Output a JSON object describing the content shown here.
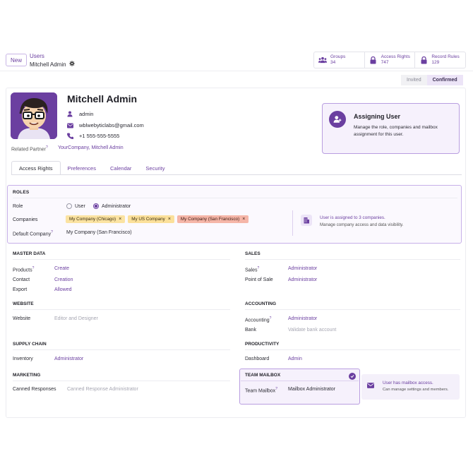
{
  "breadcrumb": {
    "parent": "Users",
    "current": "Mitchell Admin"
  },
  "buttons": {
    "new_label": "New"
  },
  "stats": [
    {
      "label": "Groups",
      "value": "34",
      "icon": "users-icon"
    },
    {
      "label": "Access Rights",
      "value": "747",
      "icon": "lock-icon"
    },
    {
      "label": "Record Rules",
      "value": "129",
      "icon": "lock-icon"
    }
  ],
  "status": {
    "invited": "Invited",
    "confirmed": "Confirmed"
  },
  "user": {
    "name": "Mitchell Admin",
    "login": "admin",
    "email": "wblwebyticlabs@gmail.com",
    "phone": "+1 555-555-5555",
    "related_partner_label": "Related Partner",
    "related_partner_value": "YourCompany, Mitchell Admin",
    "help_mark": "?"
  },
  "assign_card": {
    "title": "Assigning User",
    "desc": "Manage the role, companies and mailbox assignment for this user."
  },
  "tabs": [
    "Access Rights",
    "Preferences",
    "Calendar",
    "Security"
  ],
  "roles": {
    "title": "ROLES",
    "role_label": "Role",
    "role_options": [
      "User",
      "Administrator"
    ],
    "selected_role": "Administrator",
    "companies_label": "Companies",
    "companies": [
      "My Company (Chicago)",
      "My US Company",
      "My Company (San Francisco)"
    ],
    "default_company_label": "Default Company",
    "default_company_value": "My Company (San Francisco)",
    "info_title": "User is assigned to 3 companies.",
    "info_desc": "Manage company access and data visibility."
  },
  "sections": {
    "master_data": {
      "title": "MASTER DATA",
      "rows": [
        {
          "label": "Products",
          "value": "Create"
        },
        {
          "label": "Contact",
          "value": "Creation"
        },
        {
          "label": "Export",
          "value": "Allowed"
        }
      ]
    },
    "sales": {
      "title": "SALES",
      "rows": [
        {
          "label": "Sales",
          "value": "Administrator"
        },
        {
          "label": "Point of Sale",
          "value": "Administrator"
        }
      ]
    },
    "website": {
      "title": "WEBSITE",
      "rows": [
        {
          "label": "Website",
          "value": "Editor and Designer"
        }
      ]
    },
    "accounting": {
      "title": "ACCOUNTING",
      "rows": [
        {
          "label": "Accounting",
          "value": "Administrator"
        },
        {
          "label": "Bank",
          "value": "Validate bank account"
        }
      ]
    },
    "supply_chain": {
      "title": "SUPPLY CHAIN",
      "rows": [
        {
          "label": "Inventory",
          "value": "Administrator"
        }
      ]
    },
    "productivity": {
      "title": "PRODUCTIVITY",
      "rows": [
        {
          "label": "Dashboard",
          "value": "Admin"
        }
      ]
    },
    "marketing": {
      "title": "MARKETING",
      "rows": [
        {
          "label": "Canned Responses",
          "value": "Canned Response Administrator"
        }
      ]
    },
    "team_mailbox": {
      "title": "TEAM MAILBOX",
      "rows": [
        {
          "label": "Team Mailbox",
          "value": "Mailbox Administrator"
        }
      ]
    }
  },
  "mailbox_info": {
    "title": "User has mailbox access.",
    "desc": "Can manage settings and members."
  },
  "colors": {
    "accent": "#6b3fa0",
    "accent_light": "#f6f1fc",
    "border_accent": "#b99ee0"
  }
}
